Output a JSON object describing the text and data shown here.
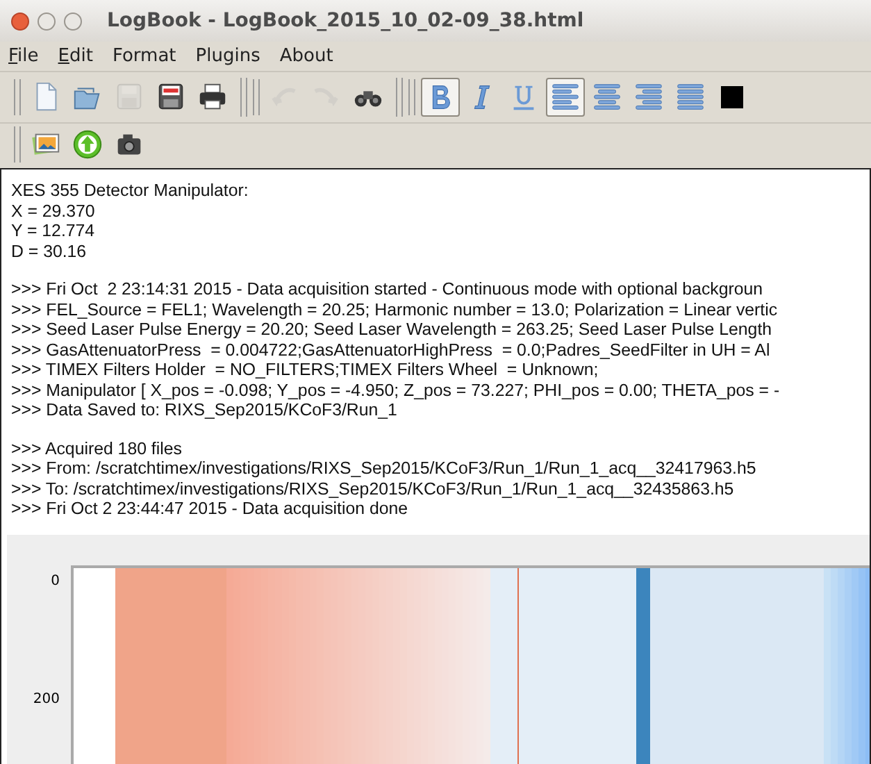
{
  "window": {
    "title": "LogBook - LogBook_2015_10_02-09_38.html"
  },
  "menu": [
    {
      "label": "File",
      "mnemonic": true
    },
    {
      "label": "Edit",
      "mnemonic": true
    },
    {
      "label": "Format",
      "mnemonic": false
    },
    {
      "label": "Plugins",
      "mnemonic": false
    },
    {
      "label": "About",
      "mnemonic": false
    }
  ],
  "toolbars": [
    [
      {
        "kind": "new",
        "disabled": false,
        "selected": false
      },
      {
        "kind": "open",
        "disabled": false,
        "selected": false
      },
      {
        "kind": "save",
        "disabled": true,
        "selected": false
      },
      {
        "kind": "pdf",
        "disabled": false,
        "selected": false
      },
      {
        "kind": "print",
        "disabled": false,
        "selected": false
      },
      {
        "kind": "sep"
      },
      {
        "kind": "undo",
        "disabled": true,
        "selected": false
      },
      {
        "kind": "redo",
        "disabled": true,
        "selected": false
      },
      {
        "kind": "find",
        "disabled": false,
        "selected": false
      },
      {
        "kind": "sep"
      },
      {
        "kind": "bold",
        "disabled": false,
        "selected": true
      },
      {
        "kind": "italic",
        "disabled": false,
        "selected": false
      },
      {
        "kind": "underline",
        "disabled": false,
        "selected": false
      },
      {
        "kind": "align-left",
        "disabled": false,
        "selected": true
      },
      {
        "kind": "align-center",
        "disabled": false,
        "selected": false
      },
      {
        "kind": "align-right",
        "disabled": false,
        "selected": false
      },
      {
        "kind": "justify",
        "disabled": false,
        "selected": false
      },
      {
        "kind": "color",
        "color": "#000000"
      }
    ],
    [
      {
        "kind": "image",
        "disabled": false,
        "selected": false
      },
      {
        "kind": "upload",
        "disabled": false,
        "selected": false
      },
      {
        "kind": "camera",
        "disabled": false,
        "selected": false
      }
    ]
  ],
  "log": [
    [
      "XES 355 Detector Manipulator:",
      "X = 29.370",
      "Y = 12.774",
      "D = 30.16"
    ],
    [
      ">>> Fri Oct  2 23:14:31 2015 - Data acquisition started - Continuous mode with optional backgroun",
      ">>> FEL_Source = FEL1; Wavelength = 20.25; Harmonic number = 13.0; Polarization = Linear vertic",
      ">>> Seed Laser Pulse Energy = 20.20; Seed Laser Wavelength = 263.25; Seed Laser Pulse Length",
      ">>> GasAttenuatorPress  = 0.004722;GasAttenuatorHighPress  = 0.0;Padres_SeedFilter in UH = Al",
      ">>> TIMEX Filters Holder  = NO_FILTERS;TIMEX Filters Wheel  = Unknown;",
      ">>> Manipulator [ X_pos = -0.098; Y_pos = -4.950; Z_pos = 73.227; PHI_pos = 0.00; THETA_pos = -",
      ">>> Data Saved to: RIXS_Sep2015/KCoF3/Run_1"
    ],
    [
      ">>> Acquired 180 files",
      ">>> From: /scratchtimex/investigations/RIXS_Sep2015/KCoF3/Run_1/Run_1_acq__32417963.h5",
      ">>> To: /scratchtimex/investigations/RIXS_Sep2015/KCoF3/Run_1/Run_1_acq__32435863.h5",
      ">>> Fri Oct 2 23:44:47 2015 - Data acquisition done"
    ]
  ],
  "plot": {
    "y_ticks": [
      "0",
      "200"
    ]
  }
}
